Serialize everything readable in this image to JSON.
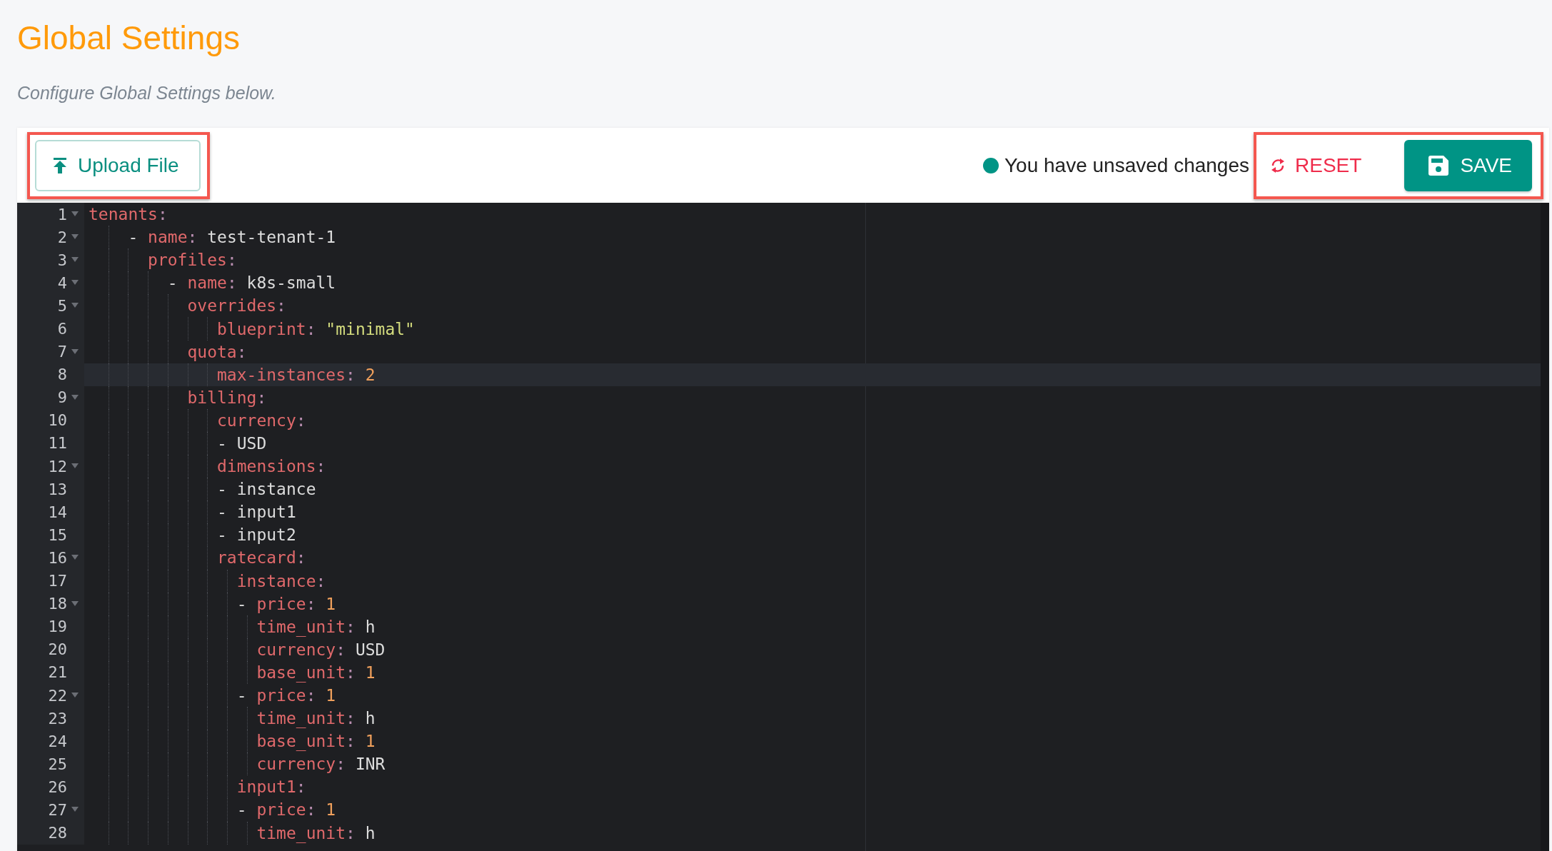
{
  "page": {
    "title": "Global Settings",
    "subtitle": "Configure Global Settings below."
  },
  "toolbar": {
    "upload_button": {
      "label": "Upload File",
      "highlighted": true
    },
    "status": {
      "unsaved": true,
      "text": "You have unsaved changes"
    },
    "actions_highlighted": true,
    "reset_button": {
      "label": "RESET"
    },
    "save_button": {
      "label": "SAVE"
    }
  },
  "editor": {
    "lines": [
      {
        "number": "1",
        "foldable": true,
        "active": false,
        "tokens": [
          {
            "kind": "key",
            "text": "tenants"
          },
          {
            "kind": "punct",
            "text": ":"
          }
        ]
      },
      {
        "number": "2",
        "foldable": true,
        "active": false,
        "tokens": [
          {
            "kind": "plain",
            "text": "    - "
          },
          {
            "kind": "key",
            "text": "name"
          },
          {
            "kind": "punct",
            "text": ": "
          },
          {
            "kind": "plain",
            "text": "test-tenant-1"
          }
        ]
      },
      {
        "number": "3",
        "foldable": true,
        "active": false,
        "tokens": [
          {
            "kind": "key",
            "text": "      profiles"
          },
          {
            "kind": "punct",
            "text": ":"
          }
        ]
      },
      {
        "number": "4",
        "foldable": true,
        "active": false,
        "tokens": [
          {
            "kind": "plain",
            "text": "        - "
          },
          {
            "kind": "key",
            "text": "name"
          },
          {
            "kind": "punct",
            "text": ": "
          },
          {
            "kind": "plain",
            "text": "k8s-small"
          }
        ]
      },
      {
        "number": "5",
        "foldable": true,
        "active": false,
        "tokens": [
          {
            "kind": "key",
            "text": "          overrides"
          },
          {
            "kind": "punct",
            "text": ":"
          }
        ]
      },
      {
        "number": "6",
        "foldable": false,
        "active": false,
        "tokens": [
          {
            "kind": "key",
            "text": "             blueprint"
          },
          {
            "kind": "punct",
            "text": ": "
          },
          {
            "kind": "string",
            "text": "\"minimal\""
          }
        ]
      },
      {
        "number": "7",
        "foldable": true,
        "active": false,
        "tokens": [
          {
            "kind": "key",
            "text": "          quota"
          },
          {
            "kind": "punct",
            "text": ":"
          }
        ]
      },
      {
        "number": "8",
        "foldable": false,
        "active": true,
        "tokens": [
          {
            "kind": "key",
            "text": "             max-instances"
          },
          {
            "kind": "punct",
            "text": ": "
          },
          {
            "kind": "number",
            "text": "2"
          }
        ]
      },
      {
        "number": "9",
        "foldable": true,
        "active": false,
        "tokens": [
          {
            "kind": "key",
            "text": "          billing"
          },
          {
            "kind": "punct",
            "text": ":"
          }
        ]
      },
      {
        "number": "10",
        "foldable": false,
        "active": false,
        "tokens": [
          {
            "kind": "key",
            "text": "             currency"
          },
          {
            "kind": "punct",
            "text": ":"
          }
        ]
      },
      {
        "number": "11",
        "foldable": false,
        "active": false,
        "tokens": [
          {
            "kind": "plain",
            "text": "             - USD"
          }
        ]
      },
      {
        "number": "12",
        "foldable": true,
        "active": false,
        "tokens": [
          {
            "kind": "key",
            "text": "             dimensions"
          },
          {
            "kind": "punct",
            "text": ":"
          }
        ]
      },
      {
        "number": "13",
        "foldable": false,
        "active": false,
        "tokens": [
          {
            "kind": "plain",
            "text": "             - instance"
          }
        ]
      },
      {
        "number": "14",
        "foldable": false,
        "active": false,
        "tokens": [
          {
            "kind": "plain",
            "text": "             - input1"
          }
        ]
      },
      {
        "number": "15",
        "foldable": false,
        "active": false,
        "tokens": [
          {
            "kind": "plain",
            "text": "             - input2"
          }
        ]
      },
      {
        "number": "16",
        "foldable": true,
        "active": false,
        "tokens": [
          {
            "kind": "key",
            "text": "             ratecard"
          },
          {
            "kind": "punct",
            "text": ":"
          }
        ]
      },
      {
        "number": "17",
        "foldable": false,
        "active": false,
        "tokens": [
          {
            "kind": "key",
            "text": "               instance"
          },
          {
            "kind": "punct",
            "text": ":"
          }
        ]
      },
      {
        "number": "18",
        "foldable": true,
        "active": false,
        "tokens": [
          {
            "kind": "plain",
            "text": "               - "
          },
          {
            "kind": "key",
            "text": "price"
          },
          {
            "kind": "punct",
            "text": ": "
          },
          {
            "kind": "number",
            "text": "1"
          }
        ]
      },
      {
        "number": "19",
        "foldable": false,
        "active": false,
        "tokens": [
          {
            "kind": "key",
            "text": "                 time_unit"
          },
          {
            "kind": "punct",
            "text": ": "
          },
          {
            "kind": "plain",
            "text": "h"
          }
        ]
      },
      {
        "number": "20",
        "foldable": false,
        "active": false,
        "tokens": [
          {
            "kind": "key",
            "text": "                 currency"
          },
          {
            "kind": "punct",
            "text": ": "
          },
          {
            "kind": "plain",
            "text": "USD"
          }
        ]
      },
      {
        "number": "21",
        "foldable": false,
        "active": false,
        "tokens": [
          {
            "kind": "key",
            "text": "                 base_unit"
          },
          {
            "kind": "punct",
            "text": ": "
          },
          {
            "kind": "number",
            "text": "1"
          }
        ]
      },
      {
        "number": "22",
        "foldable": true,
        "active": false,
        "tokens": [
          {
            "kind": "plain",
            "text": "               - "
          },
          {
            "kind": "key",
            "text": "price"
          },
          {
            "kind": "punct",
            "text": ": "
          },
          {
            "kind": "number",
            "text": "1"
          }
        ]
      },
      {
        "number": "23",
        "foldable": false,
        "active": false,
        "tokens": [
          {
            "kind": "key",
            "text": "                 time_unit"
          },
          {
            "kind": "punct",
            "text": ": "
          },
          {
            "kind": "plain",
            "text": "h"
          }
        ]
      },
      {
        "number": "24",
        "foldable": false,
        "active": false,
        "tokens": [
          {
            "kind": "key",
            "text": "                 base_unit"
          },
          {
            "kind": "punct",
            "text": ": "
          },
          {
            "kind": "number",
            "text": "1"
          }
        ]
      },
      {
        "number": "25",
        "foldable": false,
        "active": false,
        "tokens": [
          {
            "kind": "key",
            "text": "                 currency"
          },
          {
            "kind": "punct",
            "text": ": "
          },
          {
            "kind": "plain",
            "text": "INR"
          }
        ]
      },
      {
        "number": "26",
        "foldable": false,
        "active": false,
        "tokens": [
          {
            "kind": "key",
            "text": "               input1"
          },
          {
            "kind": "punct",
            "text": ":"
          }
        ]
      },
      {
        "number": "27",
        "foldable": true,
        "active": false,
        "tokens": [
          {
            "kind": "plain",
            "text": "               - "
          },
          {
            "kind": "key",
            "text": "price"
          },
          {
            "kind": "punct",
            "text": ": "
          },
          {
            "kind": "number",
            "text": "1"
          }
        ]
      },
      {
        "number": "28",
        "foldable": false,
        "active": false,
        "tokens": [
          {
            "kind": "key",
            "text": "                 time_unit"
          },
          {
            "kind": "punct",
            "text": ": "
          },
          {
            "kind": "plain",
            "text": "h"
          }
        ]
      }
    ]
  }
}
